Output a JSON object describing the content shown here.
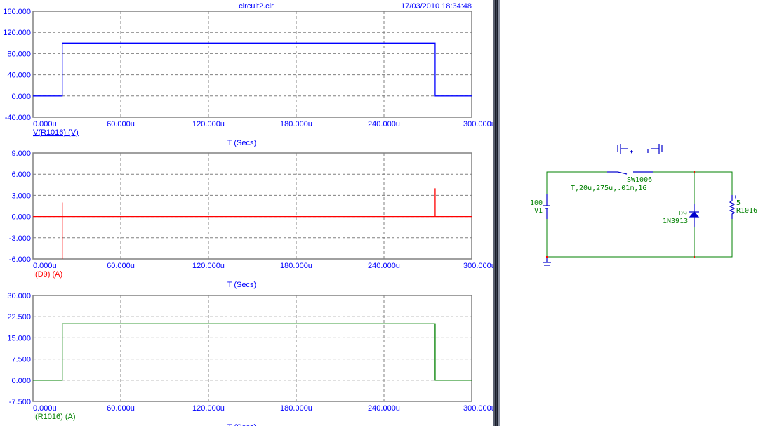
{
  "header": {
    "file_title": "circuit2.cir",
    "timestamp": "17/03/2010 18:34:48"
  },
  "colors": {
    "axis_text": "#0000ff",
    "grid": "#808080",
    "wire": "#008000",
    "component": "#0000cc",
    "junction": "#ff0000"
  },
  "chart_data": [
    {
      "type": "line",
      "series_label": "V(R1016) (V)",
      "xlabel": "T (Secs)",
      "color": "#0000ff",
      "xlim": [
        0,
        300
      ],
      "ylim": [
        -40,
        160
      ],
      "xticks": [
        "0.000u",
        "60.000u",
        "120.000u",
        "180.000u",
        "240.000u",
        "300.000u"
      ],
      "yticks": [
        "160.000",
        "120.000",
        "80.000",
        "40.000",
        "0.000",
        "-40.000"
      ],
      "grid": true,
      "x": [
        0,
        20,
        20,
        275,
        275,
        300
      ],
      "y": [
        0,
        0,
        100,
        100,
        0,
        0
      ]
    },
    {
      "type": "line",
      "series_label": "I(D9) (A)",
      "xlabel": "T (Secs)",
      "color": "#ff0000",
      "xlim": [
        0,
        300
      ],
      "ylim": [
        -6,
        9
      ],
      "xticks": [
        "0.000u",
        "60.000u",
        "120.000u",
        "180.000u",
        "240.000u",
        "300.000u"
      ],
      "yticks": [
        "9.000",
        "6.000",
        "3.000",
        "0.000",
        "-3.000",
        "-6.000"
      ],
      "grid": true,
      "x": [
        0,
        20,
        20,
        20,
        20,
        275,
        275,
        275,
        300
      ],
      "y": [
        0,
        0,
        2,
        -6,
        0,
        0,
        4,
        0,
        0
      ]
    },
    {
      "type": "line",
      "series_label": "I(R1016) (A)",
      "xlabel": "T (Secs)",
      "color": "#008000",
      "xlim": [
        0,
        300
      ],
      "ylim": [
        -7.5,
        30
      ],
      "xticks": [
        "0.000u",
        "60.000u",
        "120.000u",
        "180.000u",
        "240.000u",
        "300.000u"
      ],
      "yticks": [
        "30.000",
        "22.500",
        "15.000",
        "7.500",
        "0.000",
        "-7.500"
      ],
      "grid": true,
      "x": [
        0,
        20,
        20,
        275,
        275,
        300
      ],
      "y": [
        0,
        0,
        20,
        20,
        0,
        0
      ]
    }
  ],
  "schematic": {
    "switch_name": "SW1006",
    "switch_params": "T,20u,275u,.01m,1G",
    "source_value": "100",
    "source_name": "V1",
    "diode_name": "D9",
    "diode_model": "1N3913",
    "resistor_value": "5",
    "resistor_name": "R1016",
    "switch_plus": "+",
    "resistor_plus": "+"
  }
}
